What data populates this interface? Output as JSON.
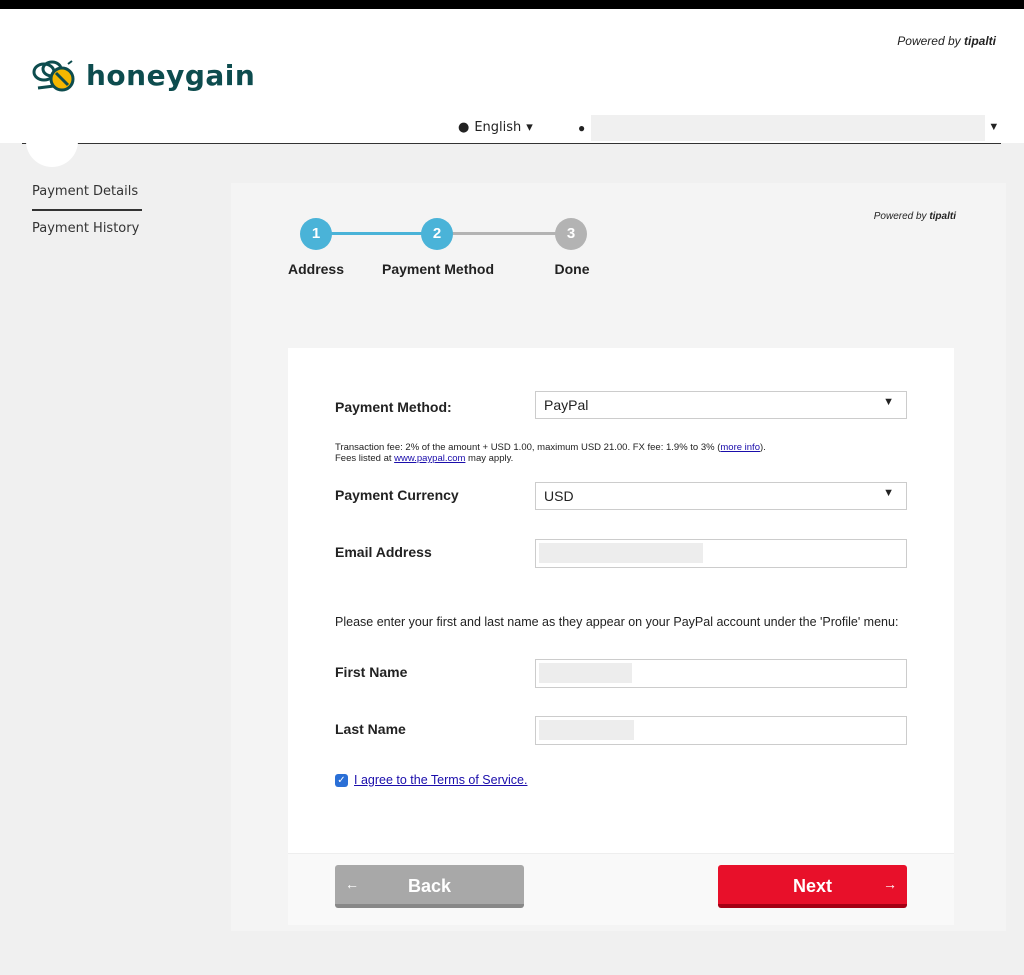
{
  "header": {
    "powered_by_prefix": "Powered by",
    "powered_by_brand": "tipalti",
    "logo_text": "honeygain",
    "language": "English"
  },
  "sidebar": {
    "items": [
      {
        "label": "Payment Details"
      },
      {
        "label": "Payment History"
      }
    ]
  },
  "panel": {
    "powered_by_prefix": "Powered by",
    "powered_by_brand": "tipalti",
    "steps": [
      {
        "number": "1",
        "label": "Address"
      },
      {
        "number": "2",
        "label": "Payment Method"
      },
      {
        "number": "3",
        "label": "Done"
      }
    ]
  },
  "form": {
    "payment_method_label": "Payment Method:",
    "payment_method_value": "PayPal",
    "fee_line1": "Transaction fee: 2% of the amount + USD 1.00, maximum USD 21.00. FX fee: 1.9% to 3% (",
    "fee_more_info": "more info",
    "fee_line1_end": ").",
    "fee_line2_prefix": "Fees listed at ",
    "fee_link": "www.paypal.com",
    "fee_line2_suffix": " may apply.",
    "currency_label": "Payment Currency",
    "currency_value": "USD",
    "email_label": "Email Address",
    "instruction": "Please enter your first and last name as they appear on your PayPal account under the 'Profile' menu:",
    "first_name_label": "First Name",
    "last_name_label": "Last Name",
    "terms_label": "I agree to the Terms of Service.",
    "terms_checked": true
  },
  "buttons": {
    "back": "Back",
    "next": "Next"
  },
  "colors": {
    "step_active": "#4ab3d8",
    "step_inactive": "#b3b3b3",
    "next_button": "#e8102a",
    "logo": "#0d4c4e"
  }
}
